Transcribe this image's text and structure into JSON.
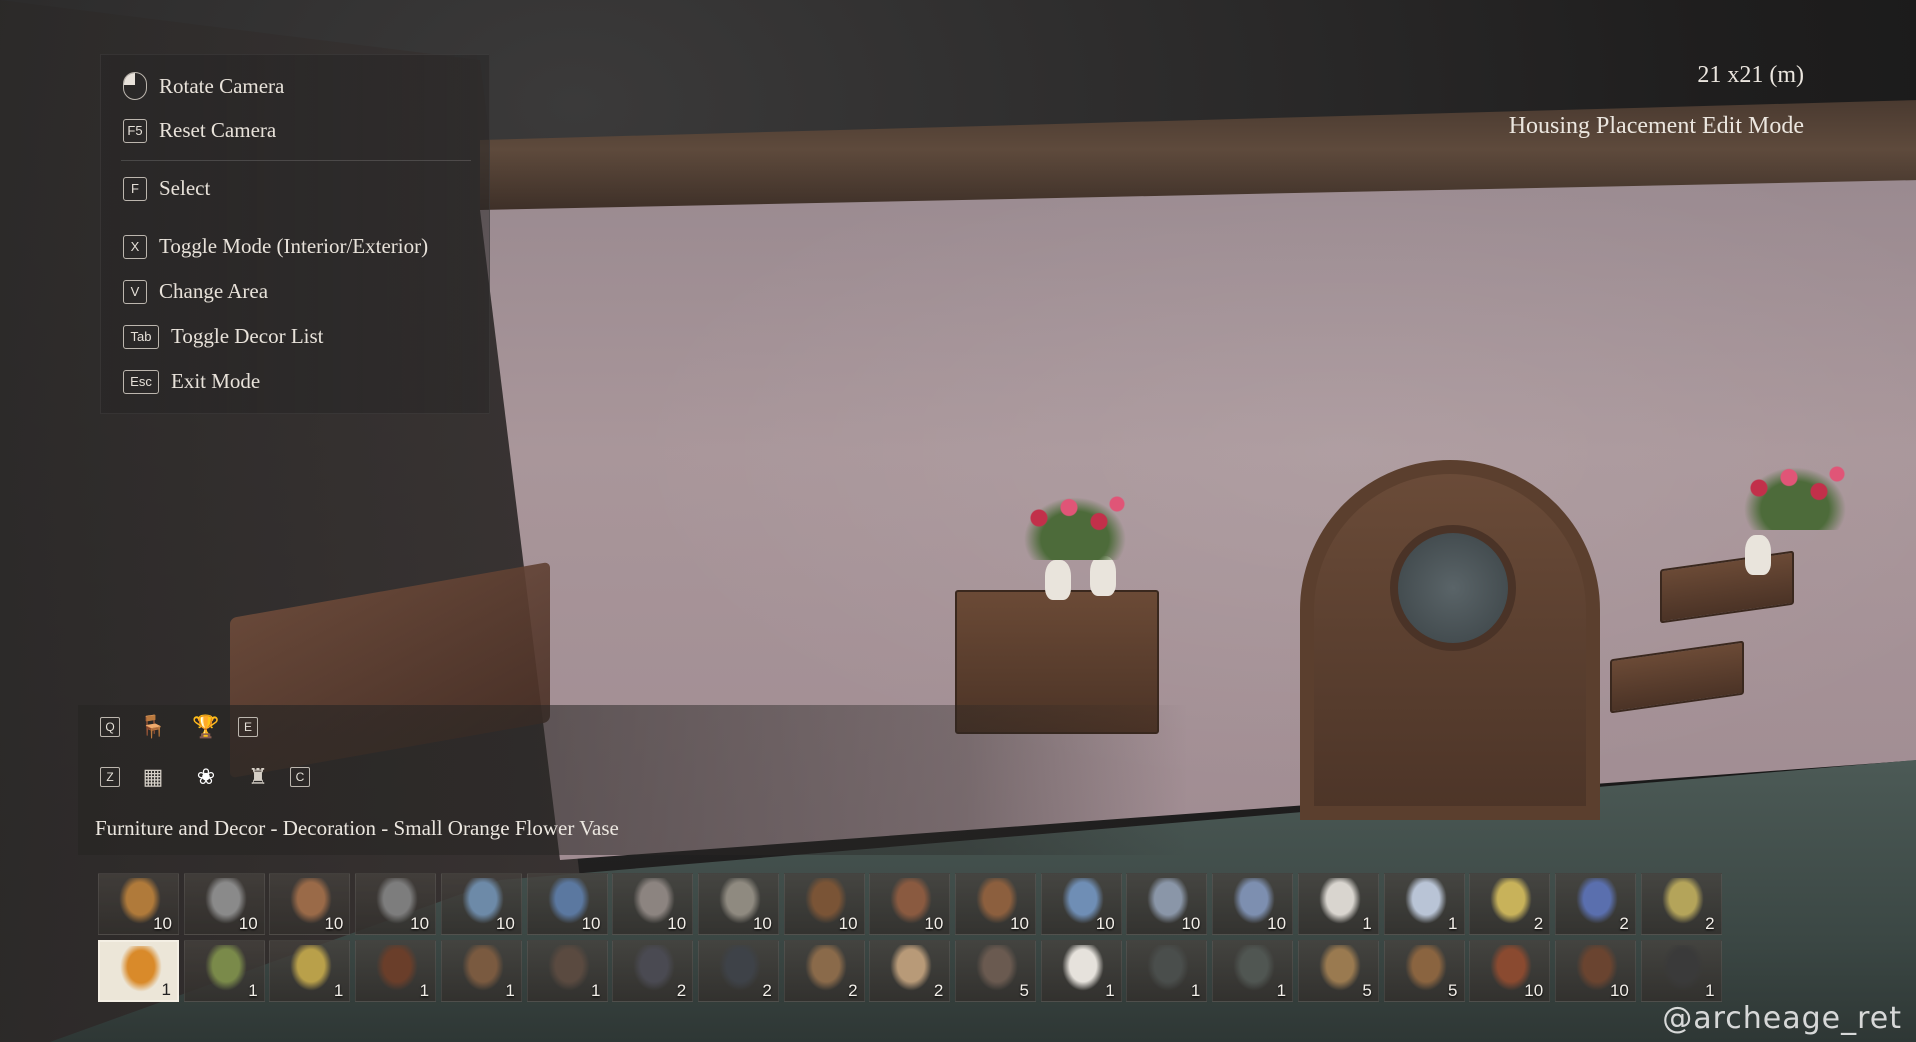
{
  "hints": [
    {
      "key": "",
      "icon": "mouse-icon",
      "label": "Rotate Camera"
    },
    {
      "key": "F5",
      "label": "Reset Camera"
    },
    {
      "key": "F",
      "label": "Select"
    },
    {
      "key": "X",
      "label": "Toggle Mode (Interior/Exterior)"
    },
    {
      "key": "V",
      "label": "Change Area"
    },
    {
      "key": "Tab",
      "label": "Toggle Decor List"
    },
    {
      "key": "Esc",
      "label": "Exit Mode"
    }
  ],
  "info": {
    "size": "21 x21 (m)",
    "mode": "Housing Placement Edit Mode"
  },
  "categories": {
    "row1": {
      "left_key": "Q",
      "right_key": "E",
      "icons": [
        "furniture-icon",
        "trophy-icon"
      ]
    },
    "row2": {
      "left_key": "Z",
      "right_key": "C",
      "icons": [
        "cabinet-icon",
        "plant-icon",
        "lamp-icon"
      ]
    }
  },
  "breadcrumb": "Furniture and Decor - Decoration - Small Orange Flower Vase",
  "slots_row1": [
    {
      "name": "vase",
      "count": "10",
      "color": "#b07a3a"
    },
    {
      "name": "pitcher",
      "count": "10",
      "color": "#8a8a8a"
    },
    {
      "name": "bowl-stack",
      "count": "10",
      "color": "#9a6a48"
    },
    {
      "name": "metal-bowls",
      "count": "10",
      "color": "#7d7d7d"
    },
    {
      "name": "blue-pot",
      "count": "10",
      "color": "#6d8aa8"
    },
    {
      "name": "blue-jar",
      "count": "10",
      "color": "#5b78a0"
    },
    {
      "name": "goblet",
      "count": "10",
      "color": "#8c8480"
    },
    {
      "name": "tankard",
      "count": "10",
      "color": "#8f8a80"
    },
    {
      "name": "wooden-mug",
      "count": "10",
      "color": "#7a5436"
    },
    {
      "name": "plate-spoon",
      "count": "10",
      "color": "#8a5a40"
    },
    {
      "name": "basket",
      "count": "10",
      "color": "#8c5f3e"
    },
    {
      "name": "blue-plates",
      "count": "10",
      "color": "#6f8eb5"
    },
    {
      "name": "patterned-plate",
      "count": "10",
      "color": "#8a96a8"
    },
    {
      "name": "plate-stack",
      "count": "10",
      "color": "#7d8fb0"
    },
    {
      "name": "white-plate",
      "count": "1",
      "color": "#d9d5cf"
    },
    {
      "name": "blue-dish",
      "count": "1",
      "color": "#b9c4d6"
    },
    {
      "name": "candle",
      "count": "2",
      "color": "#c8b25a"
    },
    {
      "name": "blue-flowers",
      "count": "2",
      "color": "#5a6fae"
    },
    {
      "name": "small-candle",
      "count": "2",
      "color": "#b4a45a"
    }
  ],
  "slots_row2": [
    {
      "name": "orange-flower-vase",
      "count": "1",
      "color": "#d98a2a",
      "selected": true
    },
    {
      "name": "flower-vase",
      "count": "1",
      "color": "#7a8a4a"
    },
    {
      "name": "yellow-flower-vase",
      "count": "1",
      "color": "#b9a04a"
    },
    {
      "name": "wall-rack",
      "count": "1",
      "color": "#6a3e2a"
    },
    {
      "name": "utensil-rack",
      "count": "1",
      "color": "#7a5a40"
    },
    {
      "name": "hanging-tools",
      "count": "1",
      "color": "#5a4a40"
    },
    {
      "name": "bottles",
      "count": "2",
      "color": "#4a4a52"
    },
    {
      "name": "dark-bottles",
      "count": "2",
      "color": "#3e4248"
    },
    {
      "name": "deer-trophy",
      "count": "2",
      "color": "#8a6a4a"
    },
    {
      "name": "animal-hide",
      "count": "2",
      "color": "#b89a78"
    },
    {
      "name": "brown-mug",
      "count": "5",
      "color": "#6a5a50"
    },
    {
      "name": "white-vase",
      "count": "1",
      "color": "#e6e2dc"
    },
    {
      "name": "round-shield",
      "count": "1",
      "color": "#4a4e4c"
    },
    {
      "name": "decor-plate",
      "count": "1",
      "color": "#505652"
    },
    {
      "name": "curtain",
      "count": "5",
      "color": "#9a7a50"
    },
    {
      "name": "curtain-rod",
      "count": "5",
      "color": "#8a6440"
    },
    {
      "name": "red-curtain",
      "count": "10",
      "color": "#8a4a30"
    },
    {
      "name": "brown-curtain",
      "count": "10",
      "color": "#6a4430"
    },
    {
      "name": "lantern",
      "count": "1",
      "color": "#3a3a3a"
    }
  ],
  "watermark": "@archeage_ret"
}
